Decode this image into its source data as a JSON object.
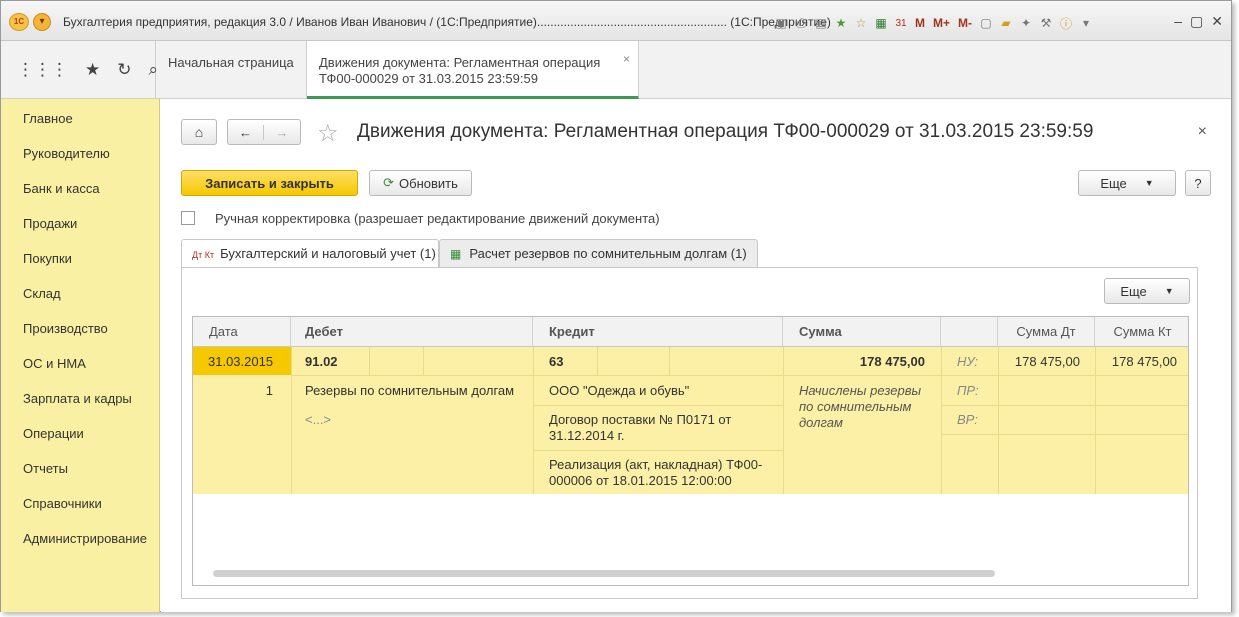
{
  "window": {
    "title": "Бухгалтерия предприятия, редакция 3.0 / Иванов Иван Иванович / (1С:Предприятие)......................................................... (1С:Предприятие)",
    "logo": "1С",
    "toolbar_m": "M",
    "toolbar_mplus": "M+",
    "toolbar_mminus": "M-",
    "calendar_day": "31"
  },
  "open_tabs": {
    "home": "Начальная страница",
    "active_line1": "Движения документа: Регламентная операция",
    "active_line2": "ТФ00-000029 от 31.03.2015 23:59:59"
  },
  "sidebar": {
    "items": [
      {
        "label": "Главное"
      },
      {
        "label": "Руководителю"
      },
      {
        "label": "Банк и касса"
      },
      {
        "label": "Продажи"
      },
      {
        "label": "Покупки"
      },
      {
        "label": "Склад"
      },
      {
        "label": "Производство"
      },
      {
        "label": "ОС и НМА"
      },
      {
        "label": "Зарплата и кадры"
      },
      {
        "label": "Операции"
      },
      {
        "label": "Отчеты"
      },
      {
        "label": "Справочники"
      },
      {
        "label": "Администрирование"
      }
    ]
  },
  "document": {
    "title": "Движения документа: Регламентная операция ТФ00-000029 от 31.03.2015 23:59:59",
    "save_close_label": "Записать и закрыть",
    "refresh_label": "Обновить",
    "more_label": "Еще",
    "help_label": "?",
    "manual_correction_label": "Ручная корректировка (разрешает редактирование движений документа)"
  },
  "tabs": [
    {
      "label": "Бухгалтерский и налоговый учет (1)",
      "icon_text": "Дт Кт"
    },
    {
      "label": "Расчет резервов по сомнительным долгам (1)"
    }
  ],
  "grid": {
    "more_label": "Еще",
    "headers": {
      "date": "Дата",
      "debit": "Дебет",
      "credit": "Кредит",
      "sum": "Сумма",
      "sum_dt": "Сумма Дт",
      "sum_kt": "Сумма Кт"
    },
    "row": {
      "date": "31.03.2015",
      "line_no": "1",
      "debit_account": "91.02",
      "debit_subconto1": "Резервы по сомнительным долгам",
      "debit_subconto2": "<...>",
      "credit_account": "63",
      "credit_subconto1": "ООО \"Одежда и обувь\"",
      "credit_subconto2": "Договор поставки № П0171 от 31.12.2014 г.",
      "credit_subconto3": "Реализация (акт, накладная) ТФ00-000006 от 18.01.2015 12:00:00",
      "sum": "178 475,00",
      "content": "Начислены резервы по сомнительным долгам",
      "nu_label": "НУ:",
      "pr_label": "ПР:",
      "vr_label": "ВР:",
      "sum_dt": "178 475,00",
      "sum_kt": "178 475,00"
    }
  }
}
